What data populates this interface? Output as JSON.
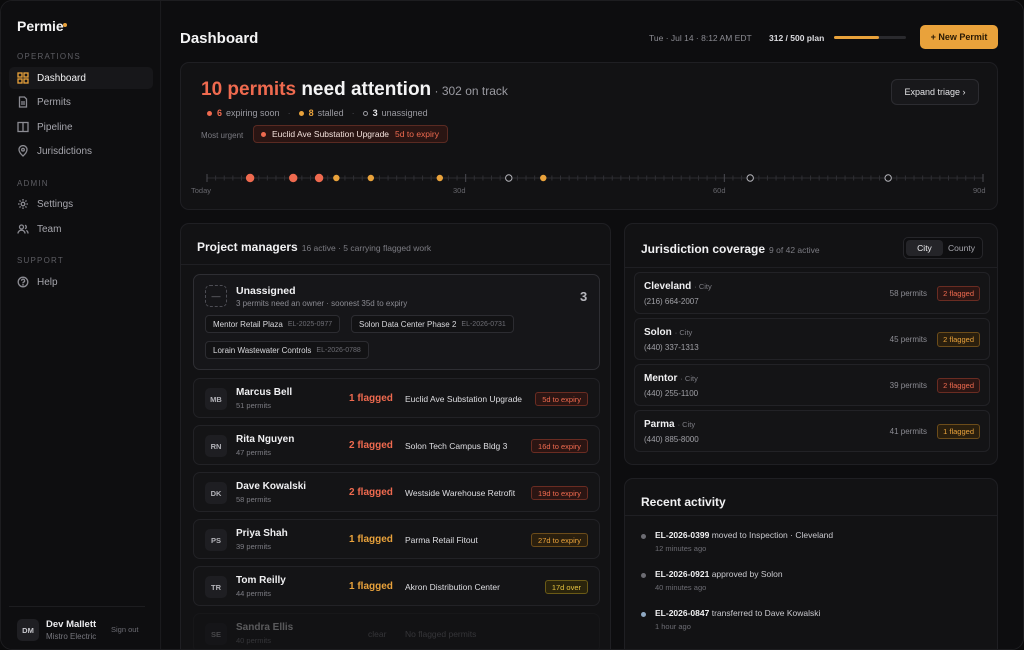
{
  "sidebar": {
    "brand": "Permie",
    "sections": {
      "operations": "OPERATIONS",
      "admin": "ADMIN",
      "support": "SUPPORT"
    },
    "items": [
      {
        "label": "Dashboard",
        "icon": "grid-icon",
        "active": true
      },
      {
        "label": "Permits",
        "icon": "document-icon",
        "active": false
      },
      {
        "label": "Pipeline",
        "icon": "columns-icon",
        "active": false
      },
      {
        "label": "Jurisdictions",
        "icon": "map-pin-icon",
        "active": false
      },
      {
        "label": "Settings",
        "icon": "gear-icon",
        "active": false
      },
      {
        "label": "Team",
        "icon": "users-icon",
        "active": false
      },
      {
        "label": "Help",
        "icon": "help-circle-icon",
        "active": false
      }
    ],
    "user": {
      "initials": "DM",
      "name": "Dev Mallett",
      "org": "Mistro Electric",
      "signout": "Sign out"
    }
  },
  "header": {
    "title": "Dashboard",
    "datetime": "Tue · Jul 14 · 8:12 AM EDT",
    "plan": "312 / 500 plan",
    "plan_fraction": 0.624,
    "new_button": "+ New Permit"
  },
  "attention": {
    "headline_hot": "10 permits",
    "headline_rest": " need attention",
    "headline_sub": " · 302 on track",
    "stats": [
      {
        "num": "6",
        "label": "expiring soon",
        "color": "#ef6a4f",
        "hollow": false
      },
      {
        "num": "8",
        "label": "stalled",
        "color": "#e9a23b",
        "hollow": false
      },
      {
        "num": "3",
        "label": "unassigned",
        "color": "#9a9aa1",
        "hollow": true
      }
    ],
    "most_urgent_label": "Most urgent",
    "most_urgent_name": "Euclid Ave Substation Upgrade",
    "most_urgent_expiry": "5d to expiry",
    "expand_button": "Expand triage ›",
    "timeline": {
      "labels": [
        "Today",
        "30d",
        "60d",
        "90d"
      ],
      "max_days": 90,
      "dots": [
        {
          "day": 5,
          "kind": "red"
        },
        {
          "day": 10,
          "kind": "red"
        },
        {
          "day": 13,
          "kind": "red"
        },
        {
          "day": 15,
          "kind": "amber"
        },
        {
          "day": 19,
          "kind": "amber"
        },
        {
          "day": 27,
          "kind": "amber"
        },
        {
          "day": 35,
          "kind": "hollow"
        },
        {
          "day": 39,
          "kind": "amber"
        },
        {
          "day": 63,
          "kind": "hollow"
        },
        {
          "day": 79,
          "kind": "hollow"
        }
      ]
    }
  },
  "project_managers": {
    "title": "Project managers",
    "meta": "16 active · 5 carrying flagged work",
    "unassigned": {
      "icon": "—",
      "title": "Unassigned",
      "sub": "3 permits need an owner · soonest 35d to expiry",
      "count": "3",
      "chips": [
        {
          "name": "Mentor Retail Plaza",
          "id": "EL-2025-0977"
        },
        {
          "name": "Solon Data Center Phase 2",
          "id": "EL-2026-0731"
        },
        {
          "name": "Lorain Wastewater Controls",
          "id": "EL-2026-0788"
        }
      ]
    },
    "rows": [
      {
        "initials": "MB",
        "name": "Marcus Bell",
        "count": "51 permits",
        "flagged": "1 flagged",
        "flag_color": "#ef6a4f",
        "project": "Euclid Ave Substation Upgrade",
        "badge": "5d to expiry",
        "badge_kind": "red"
      },
      {
        "initials": "RN",
        "name": "Rita Nguyen",
        "count": "47 permits",
        "flagged": "2 flagged",
        "flag_color": "#ef6a4f",
        "project": "Solon Tech Campus Bldg 3",
        "badge": "16d to expiry",
        "badge_kind": "red"
      },
      {
        "initials": "DK",
        "name": "Dave Kowalski",
        "count": "58 permits",
        "flagged": "2 flagged",
        "flag_color": "#ef6a4f",
        "project": "Westside Warehouse Retrofit",
        "badge": "19d to expiry",
        "badge_kind": "red"
      },
      {
        "initials": "PS",
        "name": "Priya Shah",
        "count": "39 permits",
        "flagged": "1 flagged",
        "flag_color": "#e9a23b",
        "project": "Parma Retail Fitout",
        "badge": "27d to expiry",
        "badge_kind": "amber"
      },
      {
        "initials": "TR",
        "name": "Tom Reilly",
        "count": "44 permits",
        "flagged": "1 flagged",
        "flag_color": "#e9a23b",
        "project": "Akron Distribution Center",
        "badge": "17d over",
        "badge_kind": "yellow"
      }
    ],
    "faded_row": {
      "initials": "SE",
      "name": "Sandra Ellis",
      "count": "40 permits",
      "status": "clear",
      "note": "No flagged permits"
    }
  },
  "jurisdictions": {
    "title": "Jurisdiction coverage",
    "meta": "9 of 42 active",
    "toggle": [
      "City",
      "County"
    ],
    "rows": [
      {
        "name": "Cleveland",
        "type": "· City",
        "phone": "(216) 664-2007",
        "permits": "58 permits",
        "flagged": "2 flagged",
        "kind": "red"
      },
      {
        "name": "Solon",
        "type": "· City",
        "phone": "(440) 337-1313",
        "permits": "45 permits",
        "flagged": "2 flagged",
        "kind": "amber"
      },
      {
        "name": "Mentor",
        "type": "· City",
        "phone": "(440) 255-1100",
        "permits": "39 permits",
        "flagged": "2 flagged",
        "kind": "red"
      },
      {
        "name": "Parma",
        "type": "· City",
        "phone": "(440) 885-8000",
        "permits": "41 permits",
        "flagged": "1 flagged",
        "kind": "amber"
      }
    ]
  },
  "activity": {
    "title": "Recent activity",
    "items": [
      {
        "id": "EL-2026-0399",
        "text": " moved to Inspection · Cleveland",
        "time": "12 minutes ago",
        "color": "#6c6c73"
      },
      {
        "id": "EL-2026-0921",
        "text": " approved by Solon",
        "time": "40 minutes ago",
        "color": "#6c6c73"
      },
      {
        "id": "EL-2026-0847",
        "text": " transferred to Dave Kowalski",
        "time": "1 hour ago",
        "color": "#8fa8c2"
      }
    ]
  }
}
